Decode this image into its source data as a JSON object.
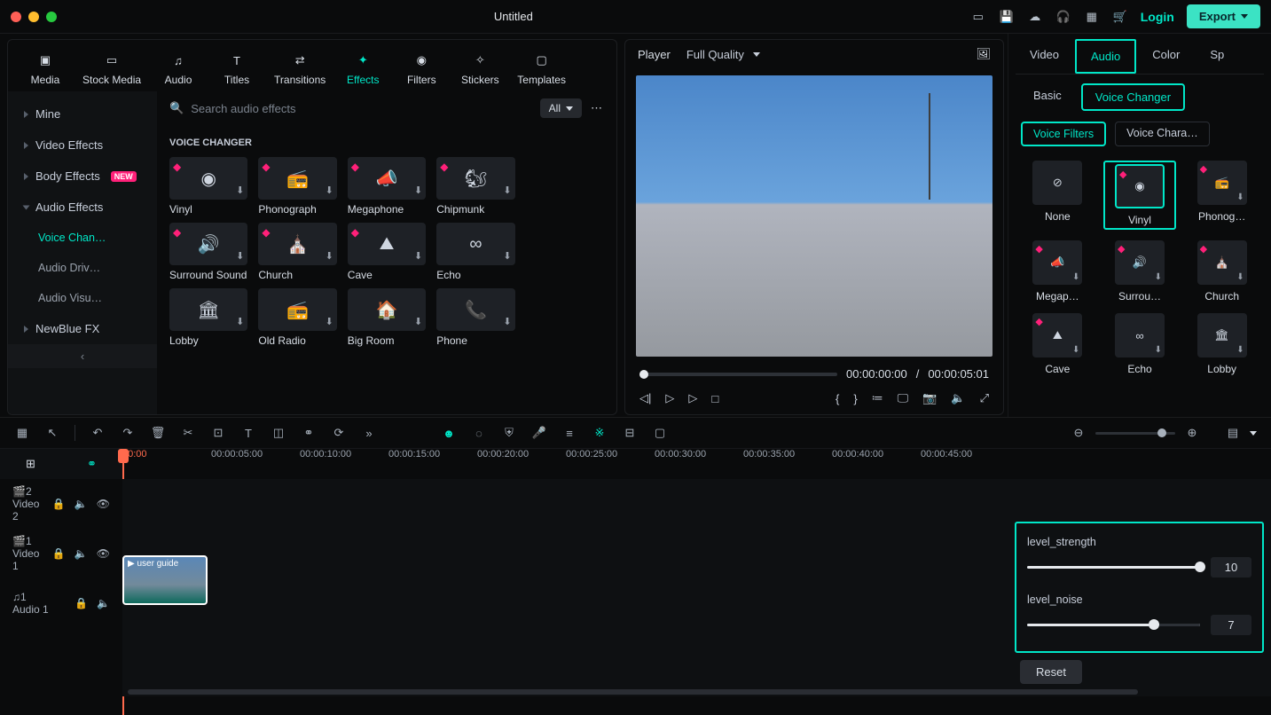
{
  "title": "Untitled",
  "header": {
    "login": "Login",
    "export": "Export"
  },
  "mediaTabs": {
    "media": "Media",
    "stock": "Stock Media",
    "audio": "Audio",
    "titles": "Titles",
    "transitions": "Transitions",
    "effects": "Effects",
    "filters": "Filters",
    "stickers": "Stickers",
    "templates": "Templates"
  },
  "leftSidebar": {
    "mine": "Mine",
    "videoEffects": "Video Effects",
    "bodyEffects": "Body Effects",
    "new": "NEW",
    "audioEffects": "Audio Effects",
    "voiceChanger": "Voice Chan…",
    "audioDriv": "Audio Driv…",
    "audioVisu": "Audio Visu…",
    "newblue": "NewBlue FX"
  },
  "search": {
    "placeholder": "Search audio effects",
    "filter": "All"
  },
  "effectsSection": {
    "header": "VOICE CHANGER",
    "items": [
      "Vinyl",
      "Phonograph",
      "Megaphone",
      "Chipmunk",
      "Surround Sound",
      "Church",
      "Cave",
      "Echo",
      "Lobby",
      "Old Radio",
      "Big Room",
      "Phone"
    ]
  },
  "player": {
    "label": "Player",
    "quality": "Full Quality",
    "current": "00:00:00:00",
    "sep": "/",
    "duration": "00:00:05:01"
  },
  "inspector": {
    "tabs": {
      "video": "Video",
      "audio": "Audio",
      "color": "Color",
      "sp": "Sp"
    },
    "subtabs": {
      "basic": "Basic",
      "voiceChanger": "Voice Changer"
    },
    "chips": {
      "voiceFilters": "Voice Filters",
      "voiceChara": "Voice Chara…"
    },
    "presets": [
      "None",
      "Vinyl",
      "Phonog…",
      "Megap…",
      "Surrou…",
      "Church",
      "Cave",
      "Echo",
      "Lobby"
    ],
    "params": {
      "strengthLabel": "level_strength",
      "strengthValue": "10",
      "noiseLabel": "level_noise",
      "noiseValue": "7"
    },
    "reset": "Reset"
  },
  "timeline": {
    "ruler": [
      "00:00",
      "00:00:05:00",
      "00:00:10:00",
      "00:00:15:00",
      "00:00:20:00",
      "00:00:25:00",
      "00:00:30:00",
      "00:00:35:00",
      "00:00:40:00",
      "00:00:45:00"
    ],
    "tracks": {
      "video2icon": "2",
      "video2": "Video 2",
      "video1icon": "1",
      "video1": "Video 1",
      "audio1icon": "1",
      "audio1": "Audio 1"
    },
    "clipLabel": "user guide"
  }
}
